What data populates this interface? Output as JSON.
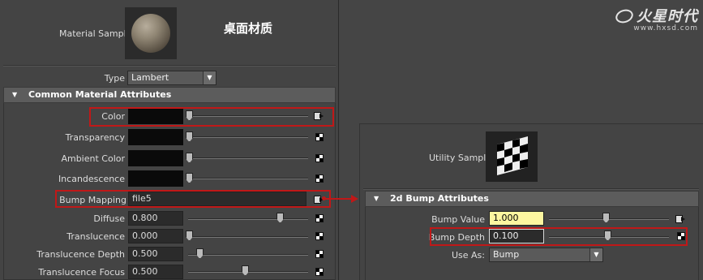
{
  "brand": {
    "name": "火星时代",
    "url": "www.hxsd.com"
  },
  "material": {
    "sample_label": "Material Sample",
    "title": "桌面材质",
    "type_label": "Type",
    "type_value": "Lambert",
    "section_title": "Common Material Attributes",
    "rows": {
      "color": {
        "label": "Color"
      },
      "transparency": {
        "label": "Transparency"
      },
      "ambient_color": {
        "label": "Ambient Color"
      },
      "incandescence": {
        "label": "Incandescence"
      },
      "bump_mapping": {
        "label": "Bump Mapping",
        "value": "file5"
      },
      "diffuse": {
        "label": "Diffuse",
        "value": "0.800"
      },
      "translucence": {
        "label": "Translucence",
        "value": "0.000"
      },
      "translucence_depth": {
        "label": "Translucence Depth",
        "value": "0.500"
      },
      "translucence_focus": {
        "label": "Translucence Focus",
        "value": "0.500"
      }
    }
  },
  "utility": {
    "sample_label": "Utility Sample",
    "section_title": "2d Bump Attributes",
    "bump_value": {
      "label": "Bump Value",
      "value": "1.000"
    },
    "bump_depth": {
      "label": "Bump Depth",
      "value": "0.100"
    },
    "use_as": {
      "label": "Use As:",
      "value": "Bump"
    }
  },
  "colors": {
    "highlight": "#c01818",
    "panel_bg": "#444444",
    "bump_value_field": "#fdf6a0"
  }
}
